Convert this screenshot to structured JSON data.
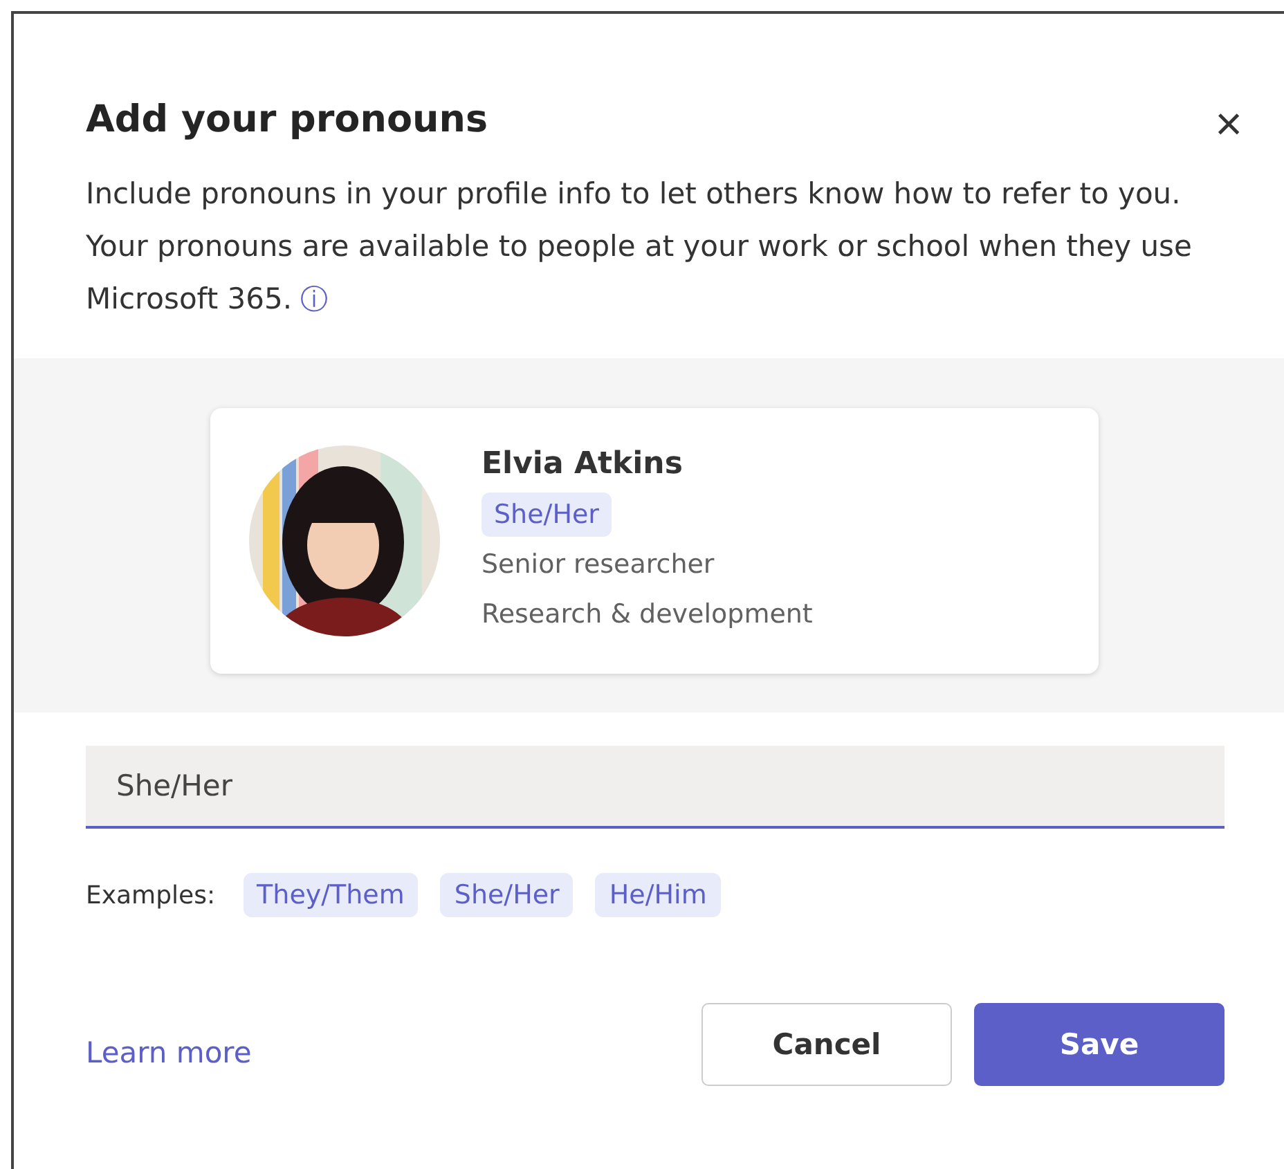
{
  "dialog": {
    "title": "Add your pronouns",
    "close_label": "×",
    "description": "Include pronouns in your profile info to let others know how to refer to you. Your pronouns are available to people at your work or school when they use Microsoft 365.",
    "info_icon": "ⓘ"
  },
  "profile_card": {
    "name": "Elvia Atkins",
    "pronouns": "She/Her",
    "title": "Senior researcher",
    "department": "Research & development"
  },
  "pronouns_field": {
    "value": "She/Her"
  },
  "examples": {
    "label": "Examples:",
    "items": [
      "They/Them",
      "She/Her",
      "He/Him"
    ]
  },
  "learn_more": "Learn more",
  "buttons": [
    {
      "label": "Cancel",
      "kind": "secondary"
    },
    {
      "label": "Save",
      "kind": "primary"
    }
  ]
}
